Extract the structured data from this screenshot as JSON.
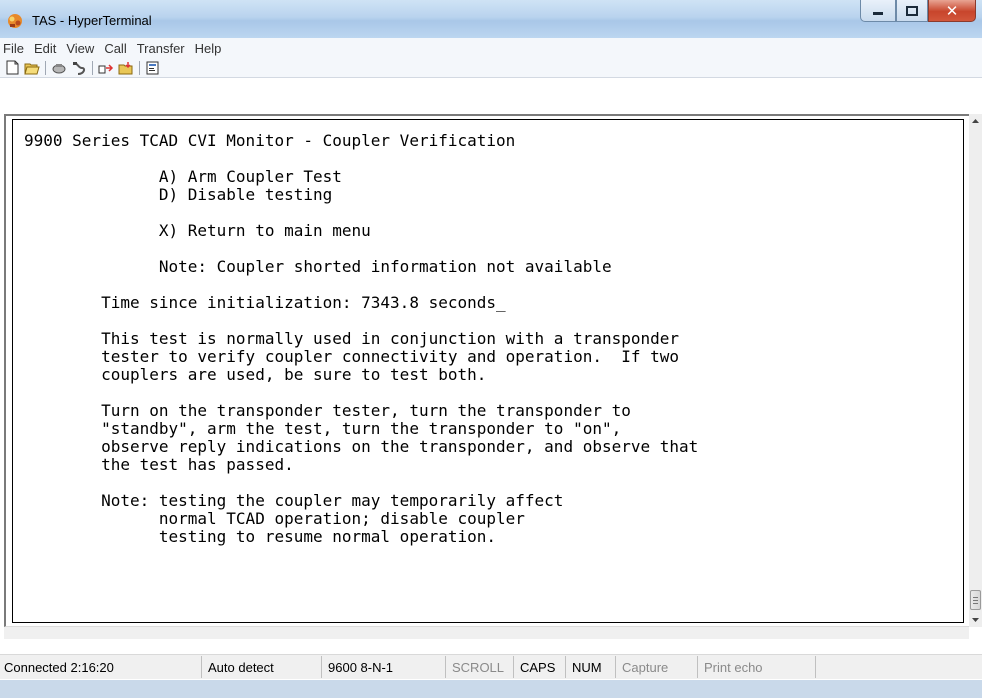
{
  "window": {
    "title": "TAS - HyperTerminal",
    "app_icon": "hyperterminal-icon",
    "controls": [
      "minimize-icon",
      "maximize-icon",
      "close-icon"
    ]
  },
  "menu": {
    "items": [
      "File",
      "Edit",
      "View",
      "Call",
      "Transfer",
      "Help"
    ]
  },
  "toolbar": {
    "buttons": [
      "new-icon",
      "open-icon",
      "connect-icon",
      "disconnect-icon",
      "send-icon",
      "receive-icon",
      "properties-icon"
    ]
  },
  "terminal": {
    "lines": [
      "9900 Series TCAD CVI Monitor - Coupler Verification",
      "",
      "              A) Arm Coupler Test",
      "              D) Disable testing",
      "",
      "              X) Return to main menu",
      "",
      "              Note: Coupler shorted information not available",
      "",
      "        Time since initialization: 7343.8 seconds_",
      "",
      "        This test is normally used in conjunction with a transponder",
      "        tester to verify coupler connectivity and operation.  If two",
      "        couplers are used, be sure to test both.",
      "",
      "        Turn on the transponder tester, turn the transponder to",
      "        \"standby\", arm the test, turn the transponder to \"on\",",
      "        observe reply indications on the transponder, and observe that",
      "        the test has passed.",
      "",
      "        Note: testing the coupler may temporarily affect",
      "              normal TCAD operation; disable coupler",
      "              testing to resume normal operation."
    ]
  },
  "status": {
    "connected": "Connected 2:16:20",
    "detect": "Auto detect",
    "settings": "9600 8-N-1",
    "scroll": "SCROLL",
    "caps": "CAPS",
    "num": "NUM",
    "capture": "Capture",
    "print_echo": "Print echo"
  }
}
